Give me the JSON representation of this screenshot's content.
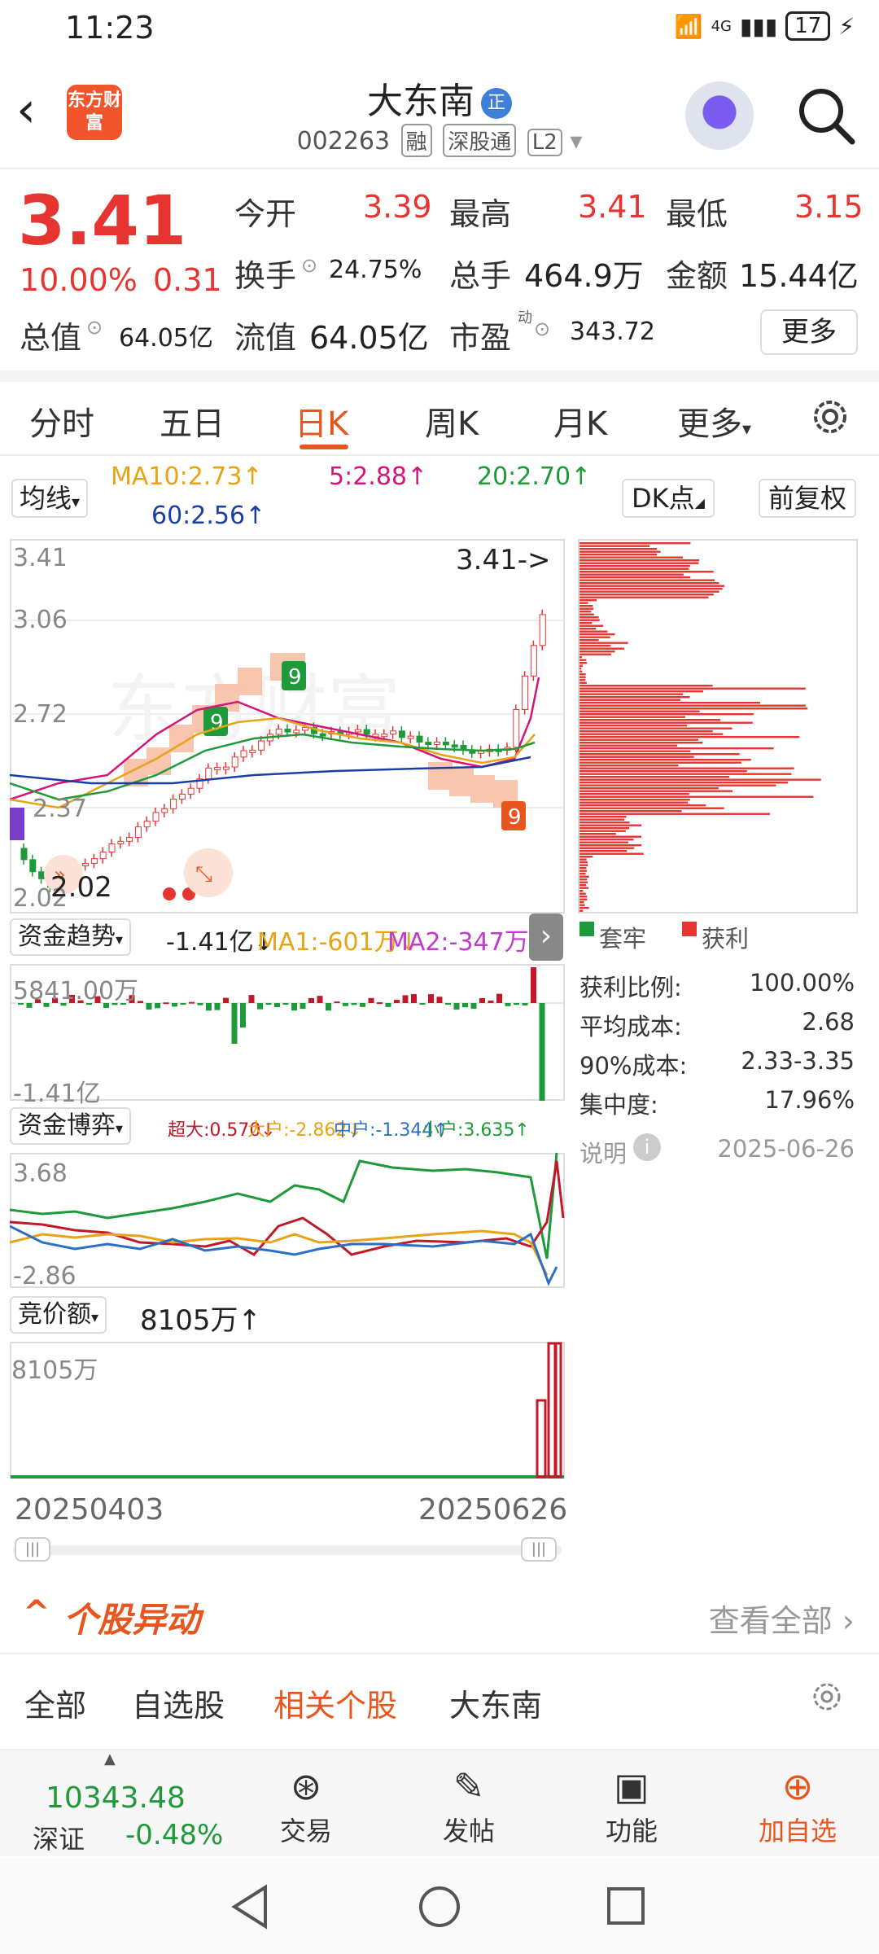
{
  "status": {
    "time": "11:23",
    "network": "4G",
    "battery": "17"
  },
  "header": {
    "logo_text": "东方财富",
    "name": "大东南",
    "badge": "正",
    "code": "002263",
    "tags": [
      "融",
      "深股通",
      "L2"
    ]
  },
  "quote": {
    "price": "3.41",
    "pct": "10.00%",
    "change": "0.31",
    "open_label": "今开",
    "open": "3.39",
    "high_label": "最高",
    "high": "3.41",
    "low_label": "最低",
    "low": "3.15",
    "turnover_label": "换手",
    "turnover": "24.75%",
    "volume_label": "总手",
    "volume": "464.9万",
    "amount_label": "金额",
    "amount": "15.44亿",
    "total_value_label": "总值",
    "total_value": "64.05亿",
    "float_value_label": "流值",
    "float_value": "64.05亿",
    "pe_label": "市盈",
    "pe_sup": "动",
    "pe": "343.72",
    "more": "更多"
  },
  "tabs": [
    "分时",
    "五日",
    "日K",
    "周K",
    "月K",
    "更多"
  ],
  "active_tab": "日K",
  "ma": {
    "button": "均线",
    "ma10": "MA10:2.73↑",
    "ma5": "5:2.88↑",
    "ma20": "20:2.70↑",
    "ma60": "60:2.56↑",
    "dk": "DK点",
    "fq": "前复权"
  },
  "kline": {
    "y_top": "3.41",
    "y_2": "3.06",
    "y_3": "2.72",
    "y_4": "2.37",
    "y_bottom": "2.02",
    "last_label": "3.41->",
    "low_label": "2.02"
  },
  "chip": {
    "legend_trapped": "套牢",
    "legend_profit": "获利",
    "rows": [
      {
        "label": "获利比例:",
        "value": "100.00%"
      },
      {
        "label": "平均成本:",
        "value": "2.68"
      },
      {
        "label": "90%成本:",
        "value": "2.33-3.35"
      },
      {
        "label": "集中度:",
        "value": "17.96%"
      }
    ],
    "note_label": "说明",
    "date": "2025-06-26"
  },
  "fund_trend": {
    "button": "资金趋势",
    "value": "-1.41亿↓",
    "ma1": "MA1:-601万↓",
    "ma2": "MA2:-347万↓",
    "y_top": "5841.00万",
    "y_bottom": "-1.41亿"
  },
  "fund_game": {
    "button": "资金博弈",
    "super": "超大:0.570↓",
    "large": "大户:-2.862↓",
    "mid": "中户:-1.344↑",
    "small": "小户:3.635↑",
    "y_top": "3.68",
    "y_bottom": "-2.86"
  },
  "auction": {
    "button": "竞价额",
    "value": "8105万↑",
    "y_top": "8105万",
    "date_start": "20250403",
    "date_end": "20250626"
  },
  "section": {
    "title": "个股异动",
    "view_all": "查看全部",
    "sub_tabs": [
      "全部",
      "自选股",
      "相关个股",
      "大东南"
    ],
    "active_sub": "相关个股"
  },
  "bottom": {
    "index_value": "10343.48",
    "index_name": "深证",
    "index_change": "-0.48%",
    "items": [
      "交易",
      "发帖",
      "功能",
      "加自选"
    ]
  },
  "colors": {
    "up": "#e63531",
    "down": "#1f9a3a",
    "accent": "#e8561f"
  }
}
